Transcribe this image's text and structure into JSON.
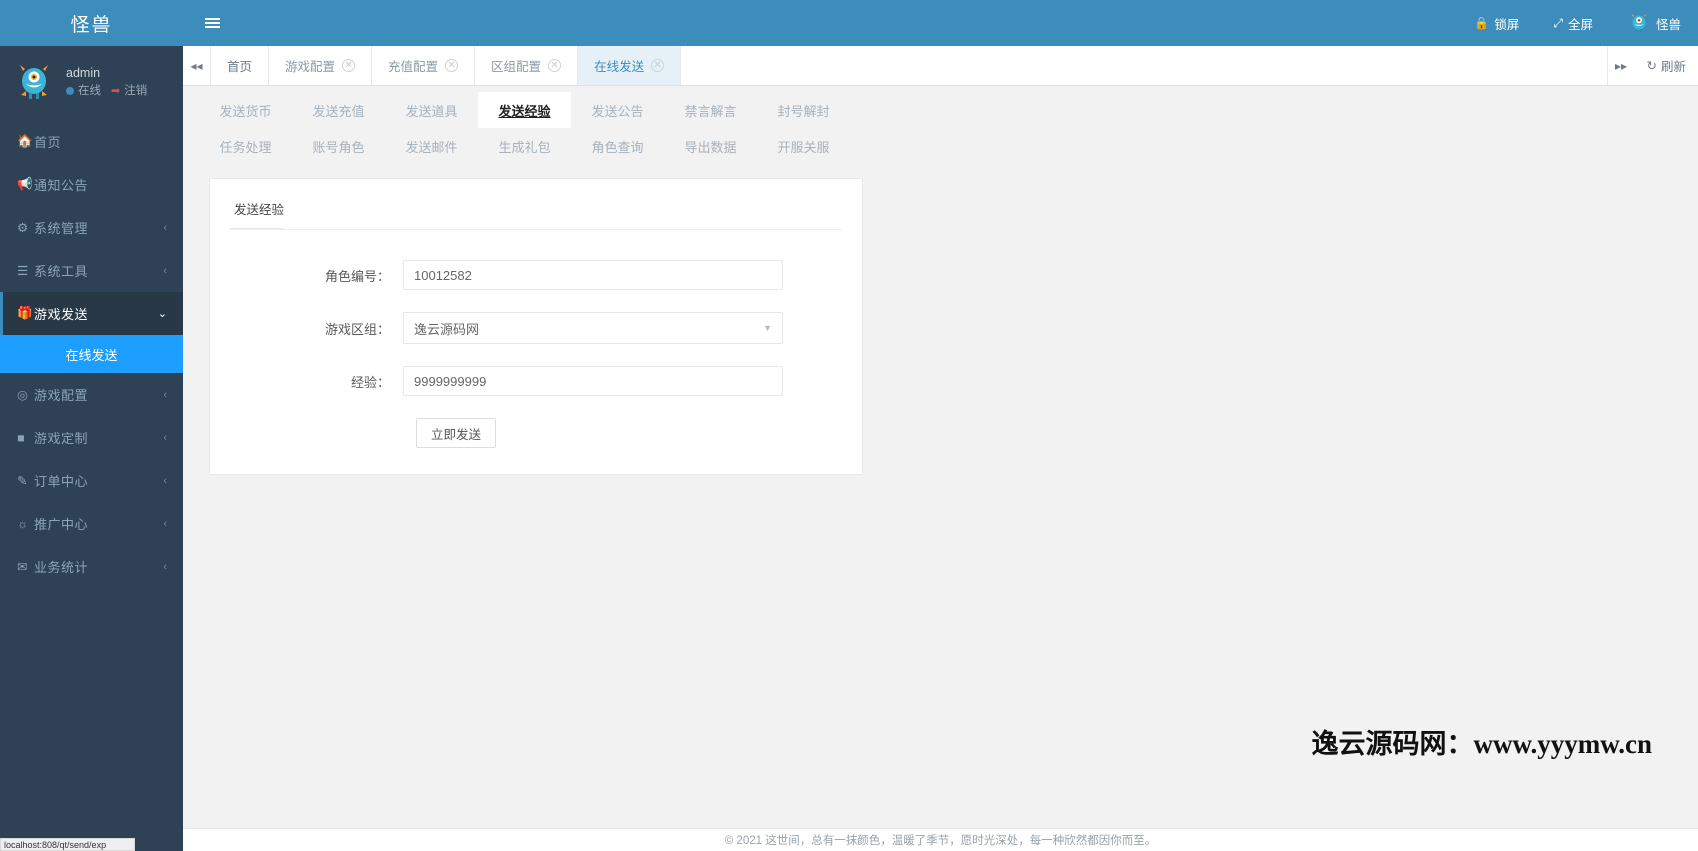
{
  "brand": {
    "title": "怪兽"
  },
  "user": {
    "name": "admin",
    "status_label": "在线",
    "logout_label": "注销",
    "avatar_icon": "monster-avatar"
  },
  "sidebar": {
    "items": [
      {
        "label": "首页",
        "icon": "home-icon",
        "arrow": ""
      },
      {
        "label": "通知公告",
        "icon": "megaphone-icon",
        "arrow": ""
      },
      {
        "label": "系统管理",
        "icon": "gear-icon",
        "arrow": "‹"
      },
      {
        "label": "系统工具",
        "icon": "list-icon",
        "arrow": "‹"
      },
      {
        "label": "游戏发送",
        "icon": "gift-icon",
        "arrow": "⌄",
        "open": true
      },
      {
        "label": "游戏配置",
        "icon": "dashboard-icon",
        "arrow": "‹"
      },
      {
        "label": "游戏定制",
        "icon": "cube-icon",
        "arrow": "‹"
      },
      {
        "label": "订单中心",
        "icon": "pen-icon",
        "arrow": "‹"
      },
      {
        "label": "推广中心",
        "icon": "handshake-icon",
        "arrow": "‹"
      },
      {
        "label": "业务统计",
        "icon": "envelope-icon",
        "arrow": "‹"
      }
    ],
    "submenu": [
      {
        "label": "在线发送",
        "active": true
      }
    ]
  },
  "header": {
    "menu_toggle_icon": "hamburger-icon",
    "actions": [
      {
        "label": "锁屏",
        "icon": "lock-icon"
      },
      {
        "label": "全屏",
        "icon": "fullscreen-icon"
      }
    ],
    "account_label": "怪兽",
    "account_icon": "monster-avatar"
  },
  "tabbar": {
    "prev_icon": "chevron-double-left-icon",
    "next_icon": "chevron-double-right-icon",
    "refresh_label": "刷新",
    "refresh_icon": "refresh-icon",
    "close_icon": "close-icon",
    "tabs": [
      {
        "label": "首页",
        "closable": false,
        "active": false
      },
      {
        "label": "游戏配置",
        "closable": true,
        "active": false
      },
      {
        "label": "充值配置",
        "closable": true,
        "active": false
      },
      {
        "label": "区组配置",
        "closable": true,
        "active": false
      },
      {
        "label": "在线发送",
        "closable": true,
        "active": true
      }
    ]
  },
  "subnav": {
    "row1": [
      {
        "label": "发送货币",
        "active": false
      },
      {
        "label": "发送充值",
        "active": false
      },
      {
        "label": "发送道具",
        "active": false
      },
      {
        "label": "发送经验",
        "active": true
      },
      {
        "label": "发送公告",
        "active": false
      },
      {
        "label": "禁言解言",
        "active": false
      },
      {
        "label": "封号解封",
        "active": false
      }
    ],
    "row2": [
      {
        "label": "任务处理",
        "active": false
      },
      {
        "label": "账号角色",
        "active": false
      },
      {
        "label": "发送邮件",
        "active": false
      },
      {
        "label": "生成礼包",
        "active": false
      },
      {
        "label": "角色查询",
        "active": false
      },
      {
        "label": "导出数据",
        "active": false
      },
      {
        "label": "开服关服",
        "active": false
      }
    ]
  },
  "panel": {
    "title": "发送经验",
    "fields": [
      {
        "label": "角色编号：",
        "value": "10012582",
        "type": "text"
      },
      {
        "label": "游戏区组：",
        "value": "逸云源码网",
        "type": "select",
        "caret": "▼"
      },
      {
        "label": "经验：",
        "value": "9999999999",
        "type": "text"
      }
    ],
    "submit_label": "立即发送"
  },
  "watermark": {
    "text": "逸云源码网：www.yyymw.cn"
  },
  "footer": {
    "copyright": "© 2021 这世间，总有一抹颜色，温暖了季节，愿时光深处，每一种欣然都因你而至。"
  },
  "statusbar": {
    "text": "localhost:808/qt/send/exp"
  },
  "colors": {
    "brand_blue": "#3c8dbc",
    "sidebar_dark": "#2f4154",
    "sidebar_active": "#1e9fff",
    "tab_active_bg": "#e6f0f7",
    "content_bg": "#f2f2f2"
  }
}
